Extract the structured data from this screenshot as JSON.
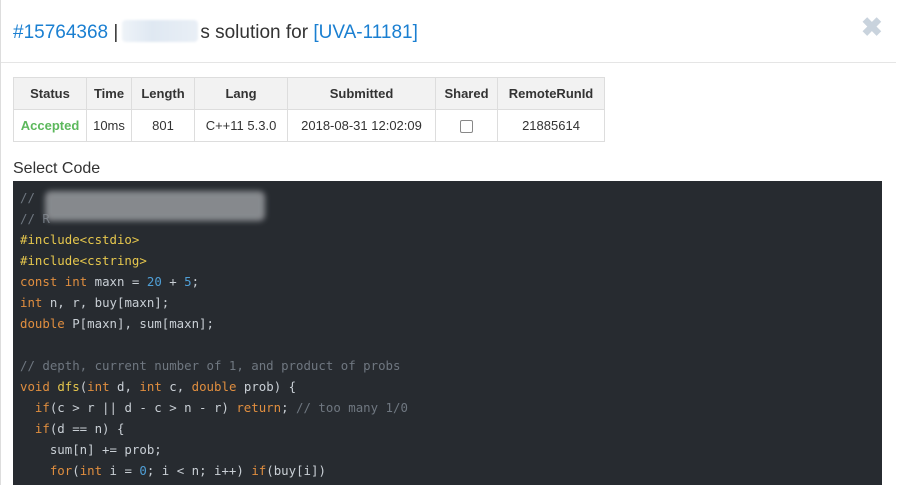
{
  "header": {
    "run_id": "#15764368",
    "separator": "|",
    "suffix": "s solution for",
    "problem": "[UVA-11181]",
    "close_glyph": "✖"
  },
  "table": {
    "headers": [
      "Status",
      "Time",
      "Length",
      "Lang",
      "Submitted",
      "Shared",
      "RemoteRunId"
    ],
    "row": {
      "status": "Accepted",
      "time": "10ms",
      "length": "801",
      "lang": "C++11 5.3.0",
      "submitted": "2018-08-31 12:02:09",
      "remote_run_id": "21885614"
    }
  },
  "select_code_label": "Select Code",
  "code_lines": [
    [
      [
        "cm",
        "//"
      ]
    ],
    [
      [
        "cm",
        "// R"
      ]
    ],
    [
      [
        "pp",
        "#include<cstdio>"
      ]
    ],
    [
      [
        "pp",
        "#include<cstring>"
      ]
    ],
    [
      [
        "kw",
        "const"
      ],
      [
        "",
        " "
      ],
      [
        "kw",
        "int"
      ],
      [
        "",
        " maxn = "
      ],
      [
        "num",
        "20"
      ],
      [
        "",
        " + "
      ],
      [
        "num",
        "5"
      ],
      [
        "",
        ";"
      ]
    ],
    [
      [
        "kw",
        "int"
      ],
      [
        "",
        " n, r, buy[maxn];"
      ]
    ],
    [
      [
        "kw",
        "double"
      ],
      [
        "",
        " P[maxn], sum[maxn];"
      ]
    ],
    [
      [
        "",
        ""
      ]
    ],
    [
      [
        "cm",
        "// depth, current number of 1, and product of probs"
      ]
    ],
    [
      [
        "kw",
        "void"
      ],
      [
        "",
        " "
      ],
      [
        "fn",
        "dfs"
      ],
      [
        "",
        "("
      ],
      [
        "kw",
        "int"
      ],
      [
        "",
        " d, "
      ],
      [
        "kw",
        "int"
      ],
      [
        "",
        " c, "
      ],
      [
        "kw",
        "double"
      ],
      [
        "",
        " prob) {"
      ]
    ],
    [
      [
        "",
        "  "
      ],
      [
        "kw",
        "if"
      ],
      [
        "",
        "(c > r || d - c > n - r) "
      ],
      [
        "kw",
        "return"
      ],
      [
        "",
        "; "
      ],
      [
        "cm",
        "// too many 1/0"
      ]
    ],
    [
      [
        "",
        "  "
      ],
      [
        "kw",
        "if"
      ],
      [
        "",
        "(d == n) {"
      ]
    ],
    [
      [
        "",
        "    sum[n] += prob;"
      ]
    ],
    [
      [
        "",
        "    "
      ],
      [
        "kw",
        "for"
      ],
      [
        "",
        "("
      ],
      [
        "kw",
        "int"
      ],
      [
        "",
        " i = "
      ],
      [
        "num",
        "0"
      ],
      [
        "",
        "; i < n; i++) "
      ],
      [
        "kw",
        "if"
      ],
      [
        "",
        "(buy[i])"
      ]
    ]
  ]
}
